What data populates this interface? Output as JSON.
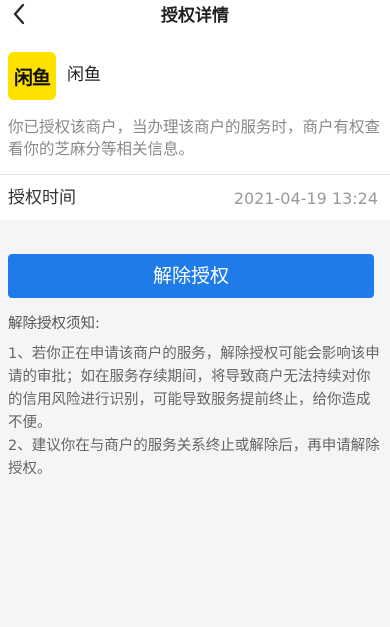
{
  "nav": {
    "title": "授权详情",
    "back_icon": "chevron-left-icon"
  },
  "merchant": {
    "logo_text": "闲鱼",
    "logo_color": "#ffe100",
    "name": "闲鱼",
    "notice": "你已授权该商户，当办理该商户的服务时，商户有权查看你的芝麻分等相关信息。"
  },
  "auth_time": {
    "label": "授权时间",
    "value": "2021-04-19 13:24"
  },
  "action": {
    "revoke_label": "解除授权",
    "button_color": "#1e7be8"
  },
  "notes": {
    "title": "解除授权须知:",
    "items": [
      "1、若你正在申请该商户的服务，解除授权可能会影响该申请的审批；如在服务存续期间，将导致商户无法持续对你的信用风险进行识别，可能导致服务提前终止，给你造成不便。",
      "2、建议你在与商户的服务关系终止或解除后，再申请解除授权。"
    ]
  }
}
